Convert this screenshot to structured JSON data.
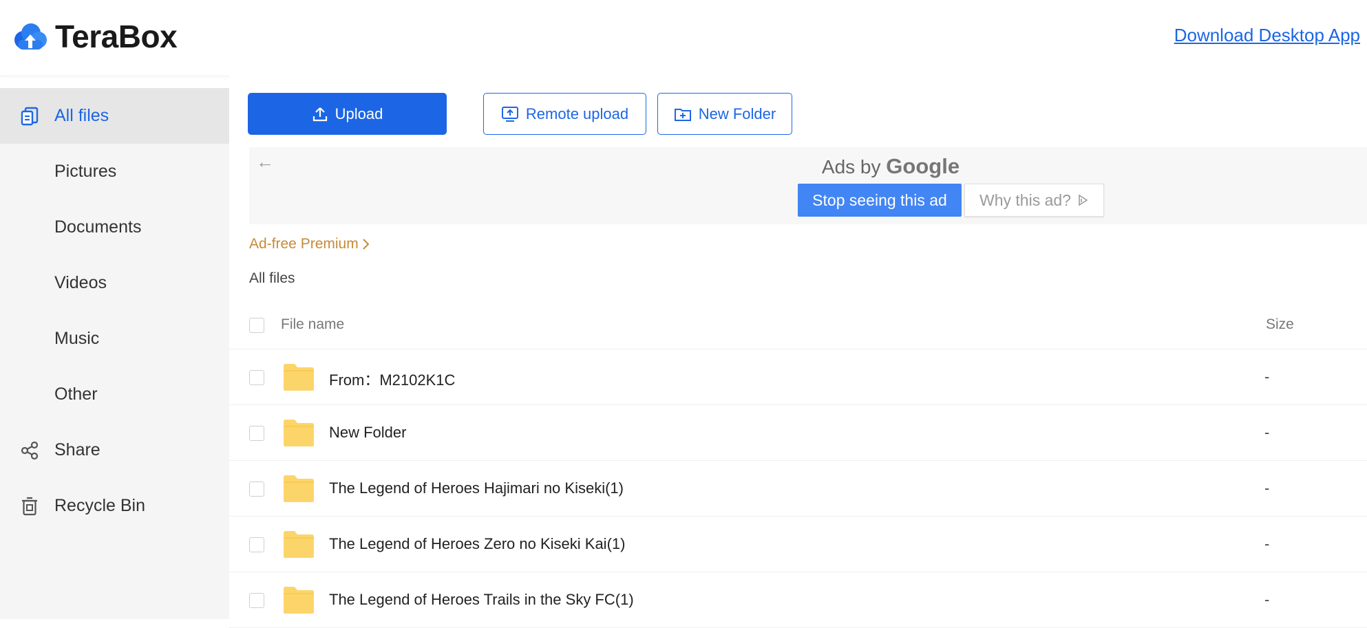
{
  "app": {
    "brand": "TeraBox",
    "download_link": "Download Desktop App"
  },
  "sidebar": {
    "items": [
      {
        "label": "All files",
        "icon": "all-files-icon",
        "active": true
      },
      {
        "label": "Pictures"
      },
      {
        "label": "Documents"
      },
      {
        "label": "Videos"
      },
      {
        "label": "Music"
      },
      {
        "label": "Other"
      },
      {
        "label": "Share",
        "icon": "share-icon"
      },
      {
        "label": "Recycle Bin",
        "icon": "trash-icon"
      }
    ]
  },
  "toolbar": {
    "upload_label": "Upload",
    "remote_upload_label": "Remote upload",
    "new_folder_label": "New Folder"
  },
  "ad": {
    "ads_by": "Ads by ",
    "google": "Google",
    "stop_label": "Stop seeing this ad",
    "why_label": "Why this ad?"
  },
  "premium_link": "Ad-free Premium",
  "breadcrumb": "All files",
  "table": {
    "columns": {
      "name": "File name",
      "size": "Size"
    },
    "rows": [
      {
        "name": "From：M2102K1C",
        "size": "-"
      },
      {
        "name": "New Folder",
        "size": "-"
      },
      {
        "name": "The Legend of Heroes Hajimari no Kiseki(1)",
        "size": "-"
      },
      {
        "name": "The Legend of Heroes Zero no Kiseki Kai(1)",
        "size": "-"
      },
      {
        "name": "The Legend of Heroes Trails in the Sky FC(1)",
        "size": "-"
      }
    ]
  },
  "colors": {
    "accent": "#1c66e5",
    "premium": "#c58a3b",
    "folder": "#fcd56a",
    "ad_button": "#4285f4"
  }
}
